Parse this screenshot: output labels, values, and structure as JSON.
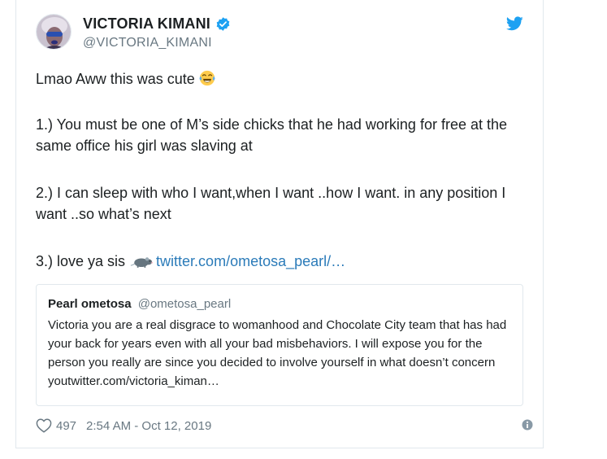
{
  "author": {
    "display_name": "VICTORIA KIMANI",
    "handle": "@VICTORIA_KIMANI",
    "verified": true
  },
  "tweet": {
    "intro": "Lmao Aww this was cute",
    "intro_emoji": "face-with-tears-of-joy-icon",
    "point_1": "1.) You must be one of M’s side chicks that he had working for free at the same office his girl was slaving at",
    "point_2": "2.) I can sleep with who I want,when I want ..how I want. in any position I want ..so what’s next",
    "point_3": "3.) love ya sis",
    "point_3_emoji": "rat-icon",
    "link_text": "twitter.com/ometosa_pearl/…"
  },
  "quoted_tweet": {
    "name": "Pearl ometosa",
    "handle": "@ometosa_pearl",
    "text": "Victoria you are a real disgrace to womanhood and Chocolate City team that has had your back for years even with all your bad misbehaviors. I will expose you for the person you really are since you decided to involve yourself in what doesn’t concern youtwitter.com/victoria_kiman…"
  },
  "footer": {
    "like_count": "497",
    "timestamp": "2:54 AM - Oct 12, 2019"
  },
  "colors": {
    "twitter_blue": "#1da1f2",
    "link_blue": "#2b7bb9",
    "secondary_text": "#697882",
    "border": "#e1e8ed"
  }
}
